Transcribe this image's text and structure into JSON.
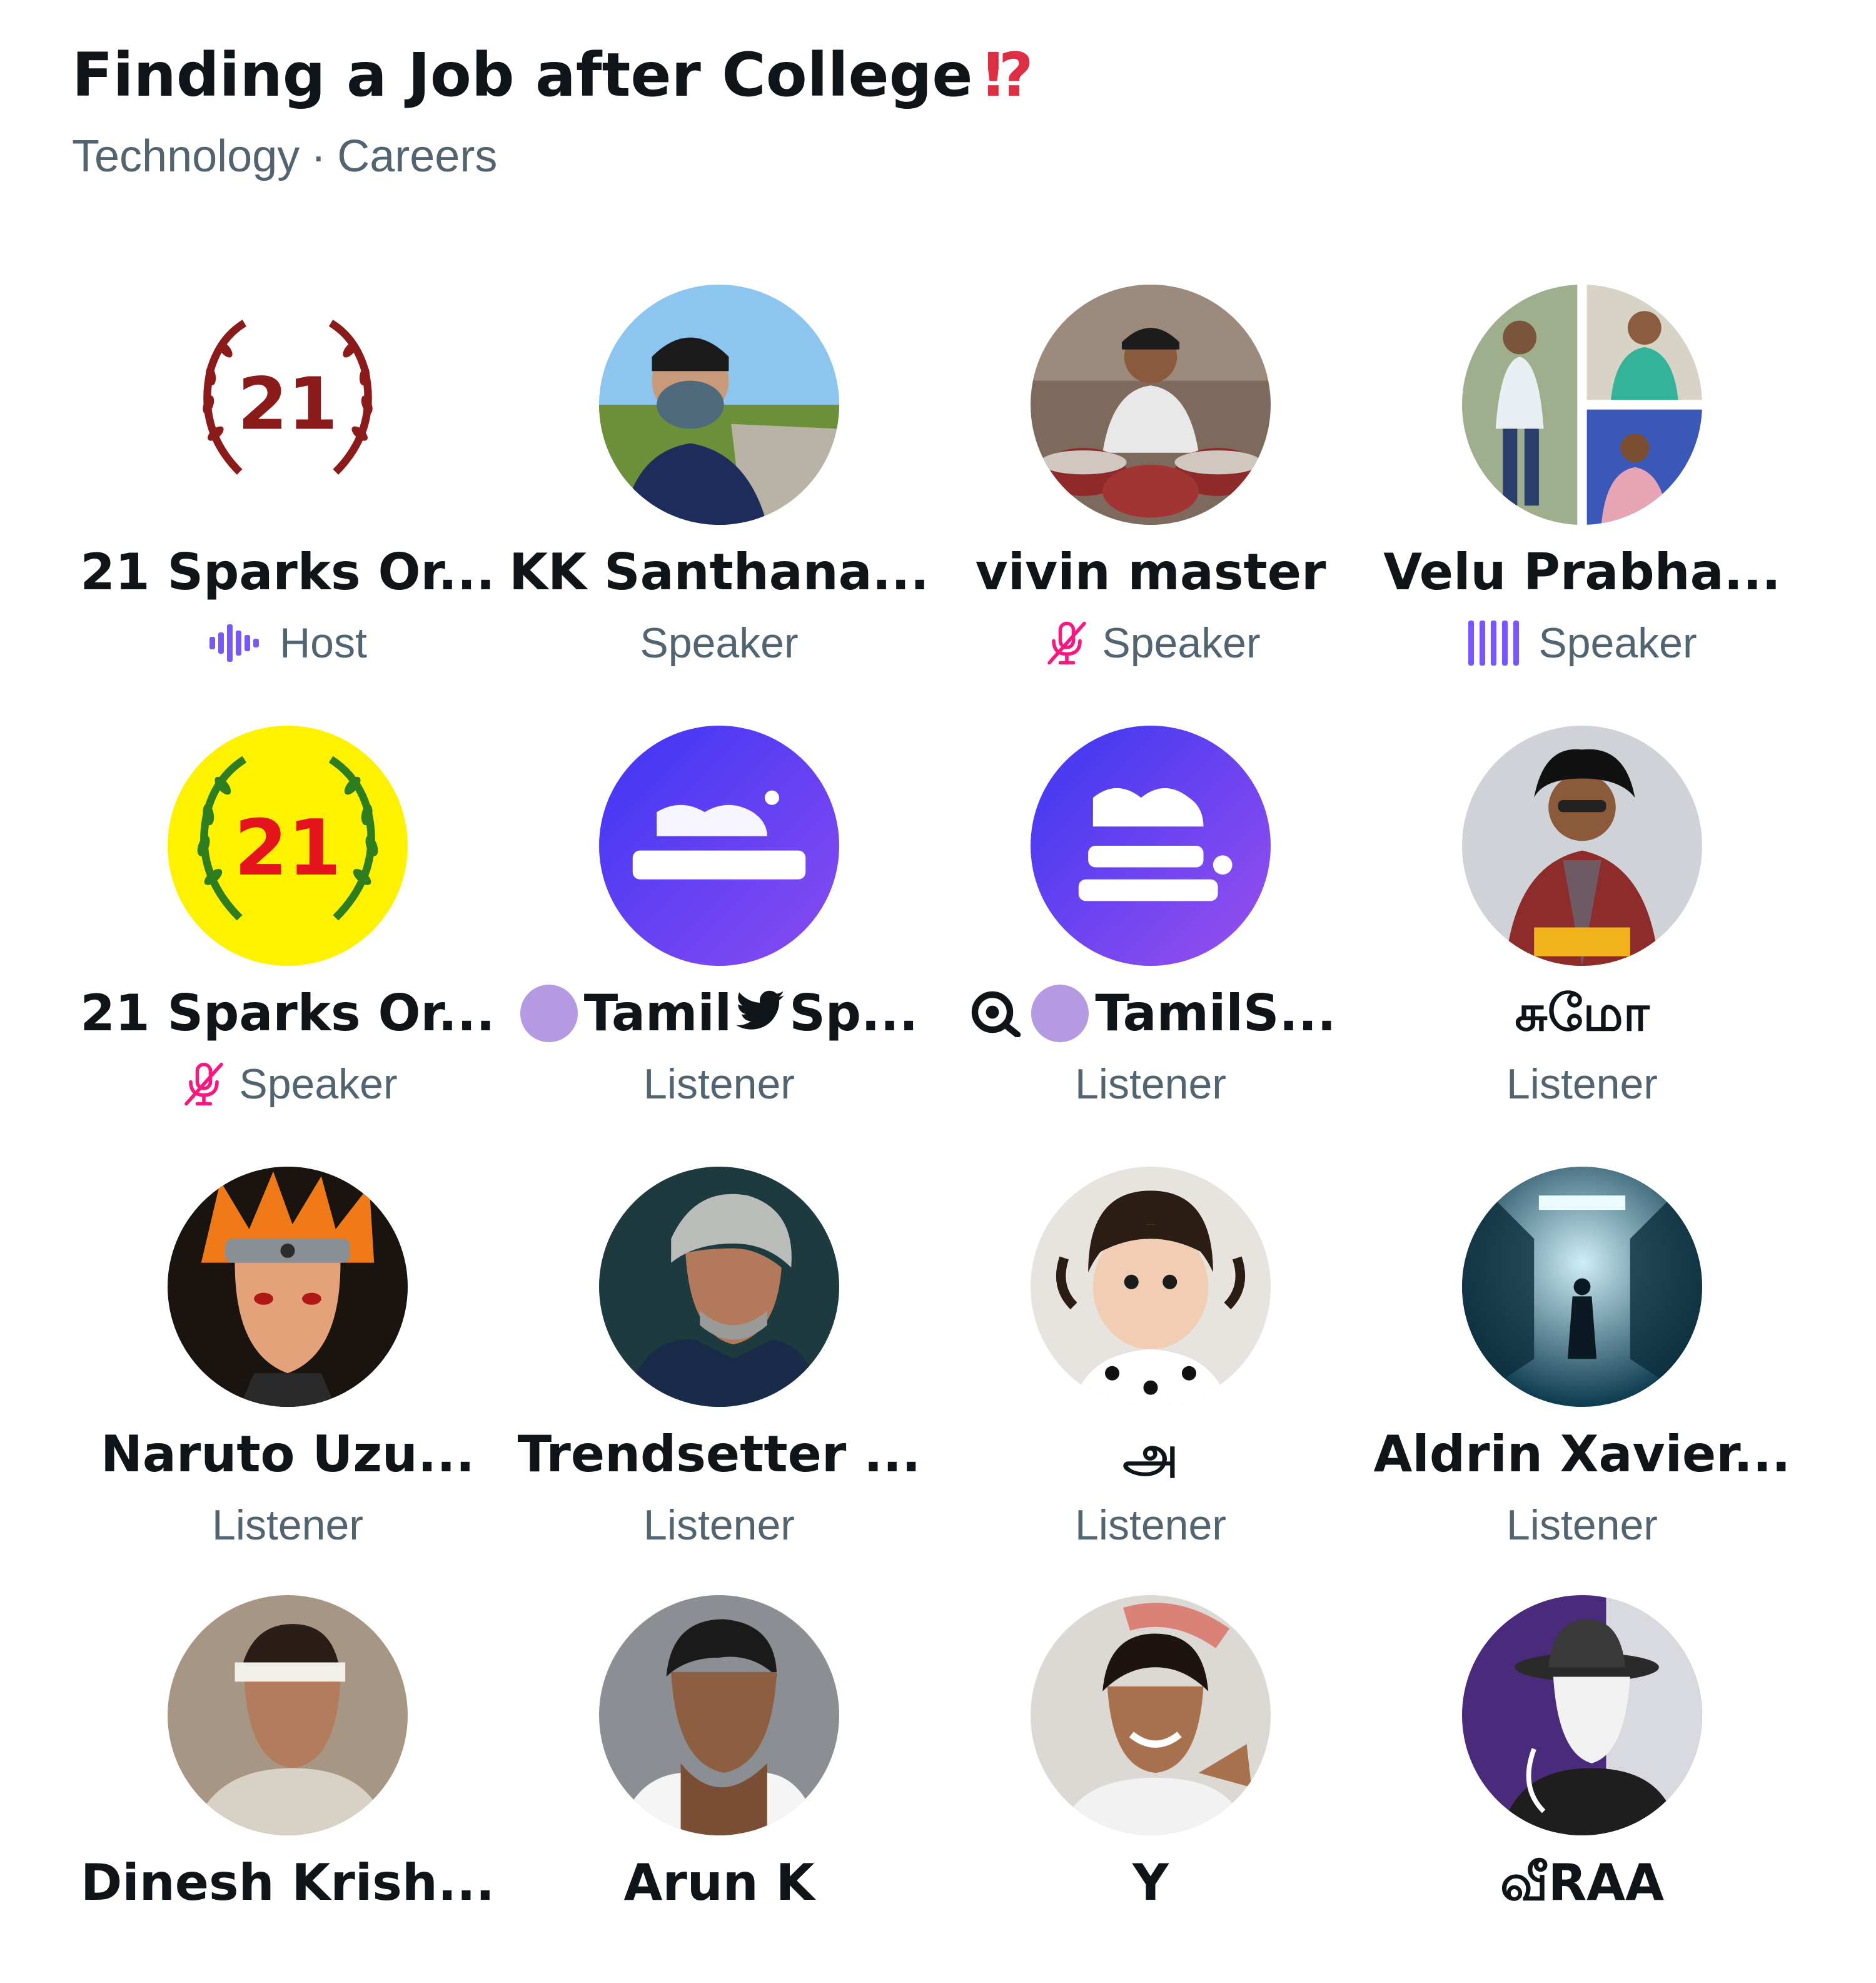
{
  "space": {
    "title": "Finding a Job after College",
    "title_emoji": "⁉",
    "topics": [
      "Technology",
      "Careers"
    ],
    "topic_separator": "·"
  },
  "participants": [
    {
      "name": "21 Sparks Or...",
      "role": "Host",
      "role_icon": "speaking-waveform-icon",
      "avatar": "laurel-21-logo-white"
    },
    {
      "name": "KK Santhana...",
      "role": "Speaker",
      "role_icon": "",
      "avatar": "masked-man-photo"
    },
    {
      "name": "vivin master",
      "role": "Speaker",
      "role_icon": "mic-muted-icon",
      "avatar": "drummer-photo"
    },
    {
      "name": "Velu Prabha...",
      "role": "Speaker",
      "role_icon": "speaking-bars-icon",
      "avatar": "collage-photo"
    },
    {
      "name": "21 Sparks Or...",
      "role": "Speaker",
      "role_icon": "mic-muted-icon",
      "avatar": "laurel-21-logo-yellow"
    },
    {
      "name_pre": "Tamil",
      "name_post": "Sp...",
      "role": "Listener",
      "badge": "purple-dot",
      "name_icon": "bird-icon",
      "avatar": "tamil-spaces-logo"
    },
    {
      "name": "TamilS...",
      "role": "Listener",
      "badge": "eye-and-purple-dot",
      "avatar": "tamil-spaces-visualizer-logo"
    },
    {
      "name": "சுமோ",
      "role": "Listener",
      "avatar": "sumo-photo"
    },
    {
      "name": "Naruto Uzu...",
      "role": "Listener",
      "avatar": "naruto-art"
    },
    {
      "name": "Trendsetter ...",
      "role": "Listener",
      "avatar": "grey-haired-man-photo"
    },
    {
      "name": "அ",
      "role": "Listener",
      "avatar": "child-photo"
    },
    {
      "name": "Aldrin Xavier...",
      "role": "Listener",
      "avatar": "corridor-art"
    },
    {
      "name": "Dinesh Krish...",
      "avatar": "headband-man-photo"
    },
    {
      "name": "Arun K",
      "avatar": "thinking-man-photo"
    },
    {
      "name": "Y",
      "avatar": "smiling-man-photo"
    },
    {
      "name": "வீRAA",
      "avatar": "hat-man-photo"
    }
  ],
  "colors": {
    "role_text": "#536471",
    "name_text": "#0f1419",
    "speaking_accent": "#7856ff",
    "muted_accent": "#f91880",
    "badge_dot": "#b49ae2",
    "title_emoji": "#dd2e44"
  }
}
